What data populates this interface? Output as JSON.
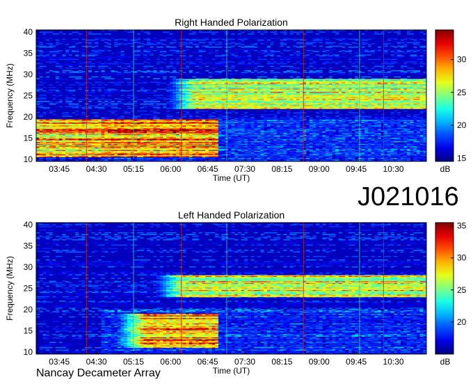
{
  "page": {
    "observation_id": "J021016",
    "footer": "Nancay Decameter Array"
  },
  "chart_data": [
    {
      "type": "heatmap",
      "title": "Right Handed Polarization",
      "xlabel": "Time (UT)",
      "ylabel": "Frequency (MHz)",
      "x_ticks": [
        "03:45",
        "04:30",
        "05:15",
        "06:00",
        "06:45",
        "07:30",
        "08:15",
        "09:00",
        "09:45",
        "10:30"
      ],
      "x_range": [
        "03:17",
        "11:10"
      ],
      "y_ticks": [
        10,
        15,
        20,
        25,
        30,
        35,
        40
      ],
      "ylim": [
        9.5,
        40.5
      ],
      "colorbar": {
        "label": "dB",
        "ticks": [
          15,
          20,
          25,
          30
        ],
        "range": [
          14.5,
          34.5
        ]
      },
      "vertical_lines_utc": [
        "04:18",
        "05:15",
        "06:13",
        "07:08",
        "08:41",
        "09:49",
        "10:18"
      ],
      "features": [
        {
          "name": "strong emission",
          "freq_mhz": [
            10.5,
            19.5
          ],
          "time_utc": [
            "03:17",
            "06:58"
          ],
          "level_db": 34
        },
        {
          "name": "emission band",
          "freq_mhz": [
            22,
            29
          ],
          "time_utc": [
            "06:30",
            "11:10"
          ],
          "level_db": 30
        }
      ]
    },
    {
      "type": "heatmap",
      "title": "Left Handed Polarization",
      "xlabel": "Time (UT)",
      "ylabel": "Frequency (MHz)",
      "x_ticks": [
        "03:45",
        "04:30",
        "05:15",
        "06:00",
        "06:45",
        "07:30",
        "08:15",
        "09:00",
        "09:45",
        "10:30"
      ],
      "x_range": [
        "03:17",
        "11:10"
      ],
      "y_ticks": [
        10,
        15,
        20,
        25,
        30,
        35,
        40
      ],
      "ylim": [
        9.5,
        40.5
      ],
      "colorbar": {
        "label": "dB",
        "ticks": [
          20,
          25,
          30,
          35
        ],
        "range": [
          15,
          35.5
        ]
      },
      "vertical_lines_utc": [
        "04:18",
        "05:15",
        "06:13",
        "07:08",
        "08:41",
        "09:49",
        "10:18"
      ],
      "features": [
        {
          "name": "strong emission",
          "freq_mhz": [
            11,
            19
          ],
          "time_utc": [
            "05:30",
            "06:58"
          ],
          "level_db": 34
        },
        {
          "name": "emission band",
          "freq_mhz": [
            23,
            28
          ],
          "time_utc": [
            "06:15",
            "11:10"
          ],
          "level_db": 32
        }
      ]
    }
  ]
}
